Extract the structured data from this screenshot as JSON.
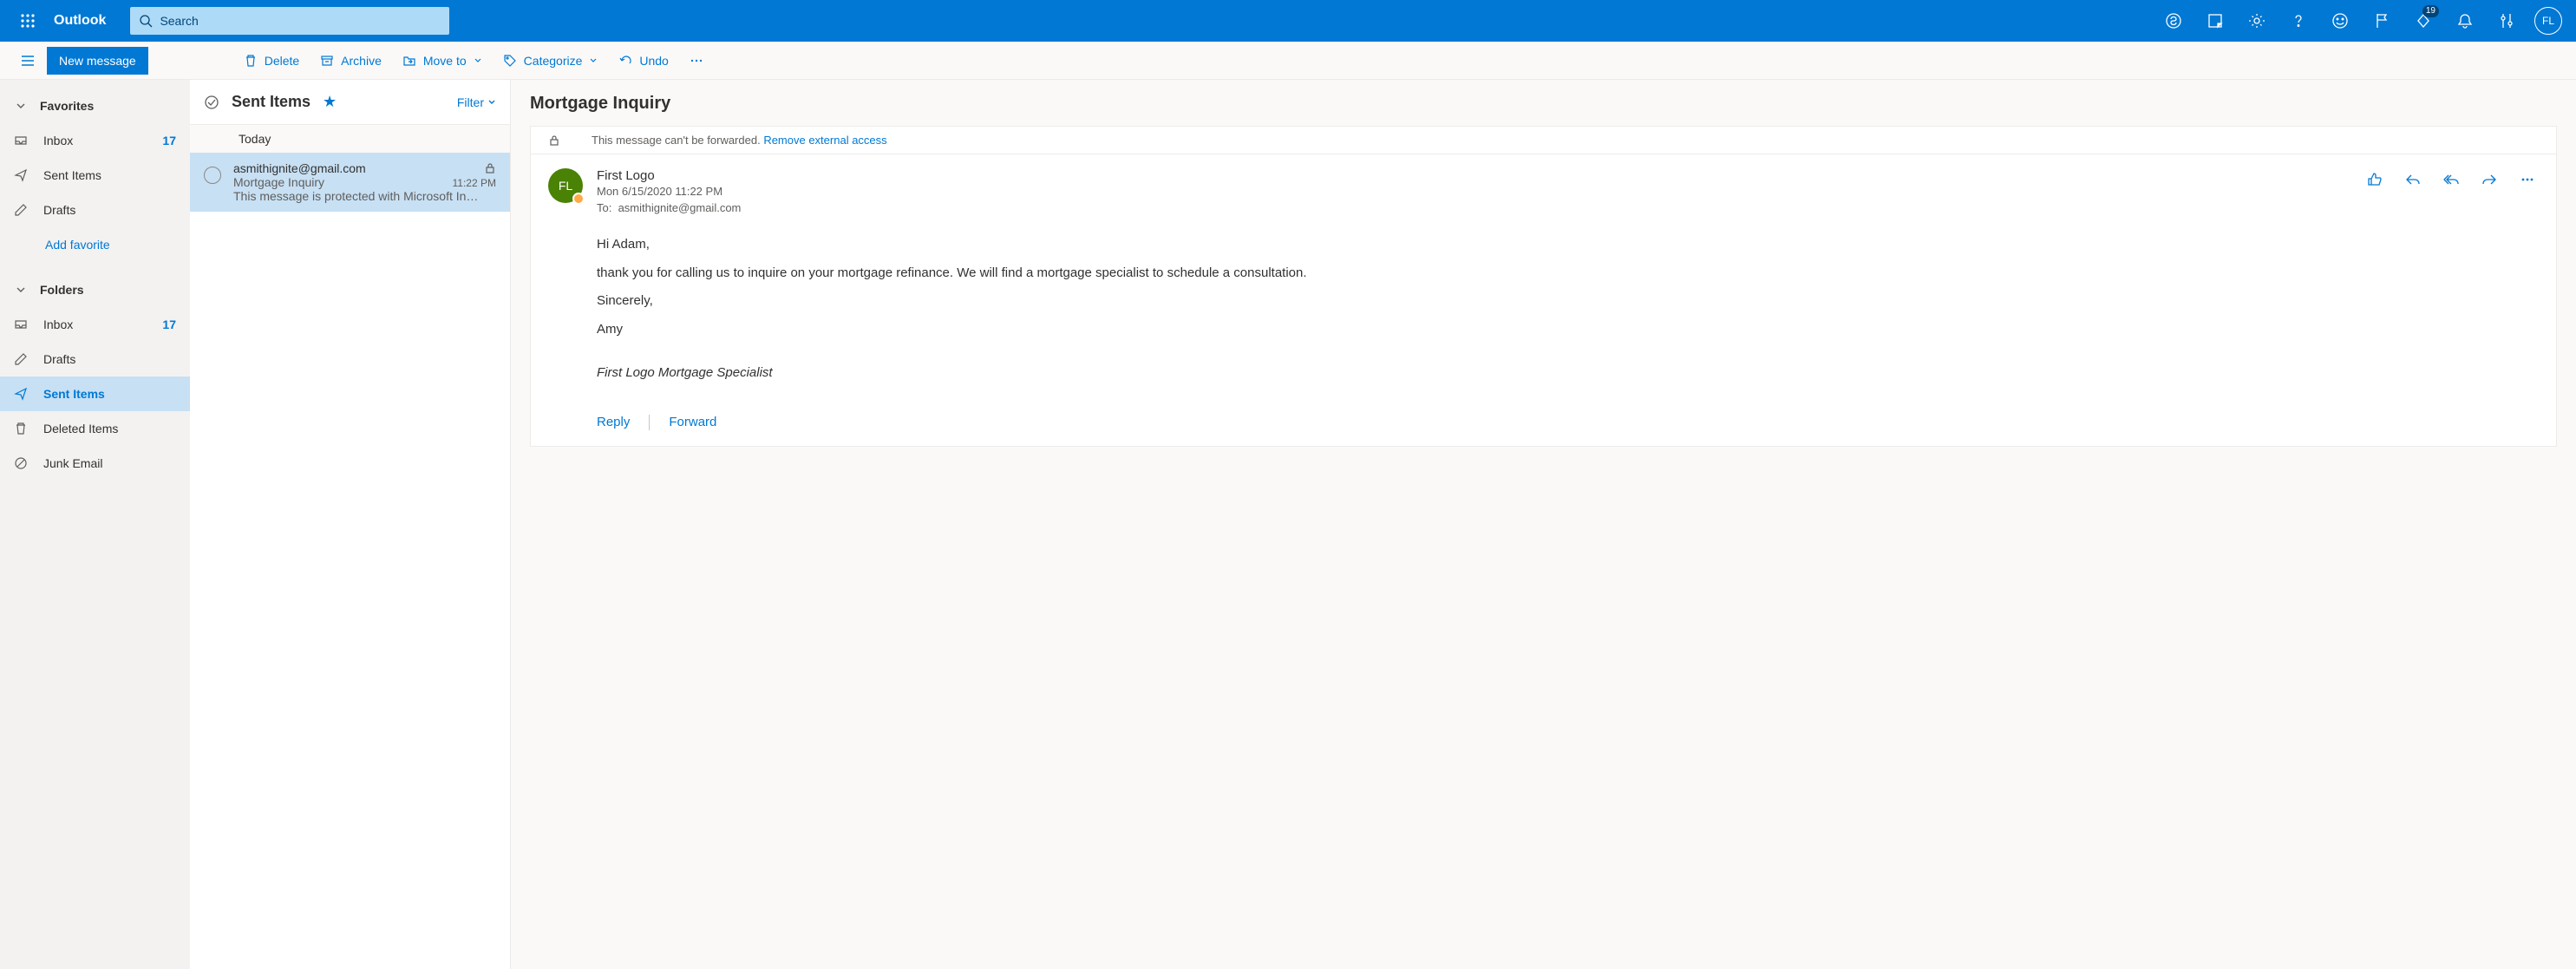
{
  "header": {
    "brand": "Outlook",
    "search_placeholder": "Search",
    "avatar_initials": "FL",
    "notification_badge": "19"
  },
  "toolbar": {
    "new_message": "New message",
    "delete": "Delete",
    "archive": "Archive",
    "move_to": "Move to",
    "categorize": "Categorize",
    "undo": "Undo"
  },
  "nav": {
    "favorites_label": "Favorites",
    "folders_label": "Folders",
    "add_favorite": "Add favorite",
    "fav": [
      {
        "label": "Inbox",
        "count": "17"
      },
      {
        "label": "Sent Items"
      },
      {
        "label": "Drafts"
      }
    ],
    "folders": [
      {
        "label": "Inbox",
        "count": "17"
      },
      {
        "label": "Drafts"
      },
      {
        "label": "Sent Items"
      },
      {
        "label": "Deleted Items"
      },
      {
        "label": "Junk Email"
      }
    ]
  },
  "list": {
    "title": "Sent Items",
    "filter": "Filter",
    "group": "Today",
    "item": {
      "from": "asmithignite@gmail.com",
      "subject": "Mortgage Inquiry",
      "time": "11:22 PM",
      "preview": "This message is protected with Microsoft In…"
    }
  },
  "reading": {
    "subject": "Mortgage Inquiry",
    "info_text": "This message can't be forwarded. ",
    "info_link": "Remove external access",
    "sender": "First Logo",
    "avatar": "FL",
    "date": "Mon 6/15/2020 11:22 PM",
    "to_label": "To:",
    "to_value": "asmithignite@gmail.com",
    "body": {
      "p1": "Hi Adam,",
      "p2": " thank you for calling us to inquire on your mortgage refinance.  We will find a mortgage specialist to schedule a consultation.",
      "p3": "Sincerely,",
      "p4": "Amy",
      "sig": "First Logo Mortgage Specialist"
    },
    "reply": "Reply",
    "forward": "Forward"
  }
}
